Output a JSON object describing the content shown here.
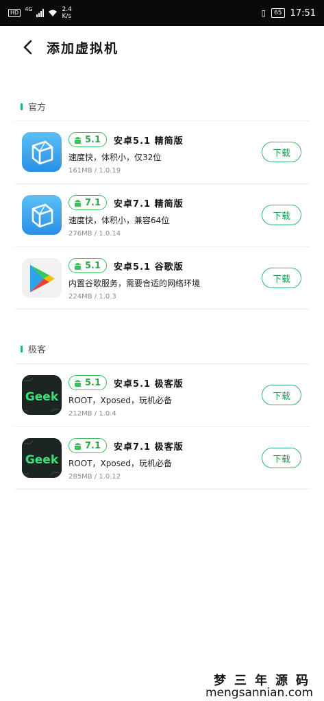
{
  "status_bar": {
    "hd": "HD",
    "network": "4G",
    "speed_value": "2.4",
    "speed_unit": "K/s",
    "battery": "65",
    "time": "17:51"
  },
  "header": {
    "title": "添加虚拟机"
  },
  "sections": [
    {
      "title": "官方",
      "items": [
        {
          "version": "5.1",
          "name": "安卓5.1 精简版",
          "desc": "速度快，体积小，仅32位",
          "meta": "161MB / 1.0.19",
          "button": "下载",
          "icon": "vmos-cube-icon"
        },
        {
          "version": "7.1",
          "name": "安卓7.1 精简版",
          "desc": "速度快，体积小，兼容64位",
          "meta": "276MB / 1.0.14",
          "button": "下载",
          "icon": "vmos-cube-icon"
        },
        {
          "version": "5.1",
          "name": "安卓5.1 谷歌版",
          "desc": "内置谷歌服务，需要合适的网络环境",
          "meta": "224MB / 1.0.3",
          "button": "下载",
          "icon": "google-play-icon"
        }
      ]
    },
    {
      "title": "极客",
      "items": [
        {
          "version": "5.1",
          "name": "安卓5.1 极客版",
          "desc": "ROOT，Xposed，玩机必备",
          "meta": "212MB / 1.0.4",
          "button": "下载",
          "icon": "geek-icon",
          "icon_text": "Geek"
        },
        {
          "version": "7.1",
          "name": "安卓7.1 极客版",
          "desc": "ROOT，Xposed，玩机必备",
          "meta": "285MB / 1.0.12",
          "button": "下载",
          "icon": "geek-icon",
          "icon_text": "Geek"
        }
      ]
    }
  ],
  "watermark": {
    "cn": "梦三年源码",
    "en": "mengsannian.com"
  },
  "colors": {
    "accent": "#35b56a",
    "badge": "#3bbf5a",
    "section_bar": "#19b394",
    "geek_text": "#39e07a"
  }
}
